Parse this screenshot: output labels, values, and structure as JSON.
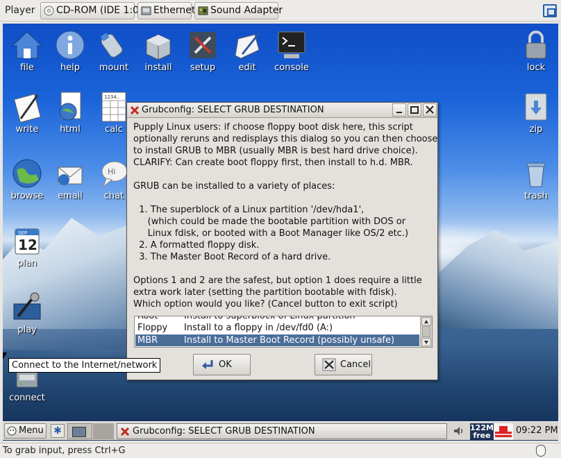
{
  "vm_toolbar": {
    "player_menu": "Player",
    "cdrom_label": "CD-ROM (IDE 1:0)",
    "ethernet_label": "Ethernet",
    "sound_label": "Sound Adapter"
  },
  "desktop_icons": {
    "file": "file",
    "help": "help",
    "mount": "mount",
    "install": "install",
    "setup": "setup",
    "edit": "edit",
    "console": "console",
    "lock": "lock",
    "write": "write",
    "html": "html",
    "calc": "calc",
    "zip": "zip",
    "browse": "browse",
    "email": "email",
    "chat": "chat",
    "trash": "trash",
    "plan": "plan",
    "play": "play",
    "connect": "connect",
    "calendar_month": "SEP",
    "calendar_day": "12",
    "calc_digits": "1234.."
  },
  "tooltip": "Connect to the Internet/network",
  "dialog": {
    "title": "Grubconfig: SELECT GRUB DESTINATION",
    "body": "Pupply Linux users: if choose floppy boot disk here, this script\noptionally reruns and redisplays this dialog so you can then choose\nto install GRUB to MBR (usually MBR is best hard drive choice).\nCLARIFY: Can create boot floppy first, then install to h.d. MBR.\n\nGRUB can be installed to a variety of places:\n\n  1. The superblock of a Linux partition '/dev/hda1',\n     (which could be made the bootable partition with DOS or\n     Linux fdisk, or booted with a Boot Manager like OS/2 etc.)\n  2. A formatted floppy disk.\n  3. The Master Boot Record of a hard drive.\n\nOptions 1 and 2 are the safest, but option 1 does require a little\nextra work later (setting the partition bootable with fdisk).\nWhich option would you like? (Cancel button to exit script)",
    "options": [
      {
        "code": "Root",
        "desc": "Install to superblock of Linux partition"
      },
      {
        "code": "Floppy",
        "desc": "Install to a floppy in /dev/fd0 (A:)"
      },
      {
        "code": "MBR",
        "desc": "Install to Master Boot Record (possibly unsafe)"
      }
    ],
    "selected": "MBR",
    "ok_label": "OK",
    "cancel_label": "Cancel"
  },
  "taskbar": {
    "menu_label": "Menu",
    "task_label": "Grubconfig: SELECT GRUB DESTINATION",
    "mem_value": "122M",
    "mem_label": "free",
    "clock": "09:22 PM"
  },
  "statusbar": {
    "text": "To grab input, press Ctrl+G"
  },
  "colors": {
    "selection": "#4b6e99",
    "desktop_sky": "#1a63d8"
  }
}
